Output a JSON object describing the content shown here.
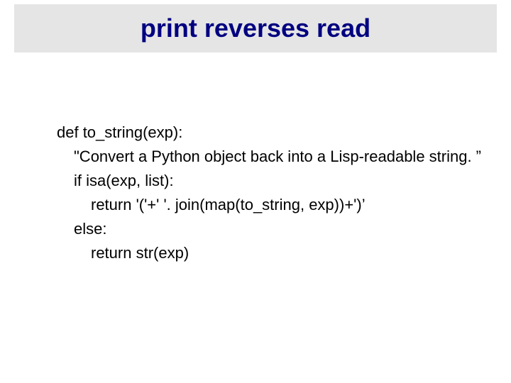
{
  "title": "print reverses read",
  "code": {
    "line1": "def to_string(exp):",
    "line2": "\"Convert a Python object back into a Lisp-readable string. ”",
    "line3": "if isa(exp, list):",
    "line4": "return '('+' '. join(map(to_string, exp))+')’",
    "line5": "else:",
    "line6": "return str(exp)"
  }
}
